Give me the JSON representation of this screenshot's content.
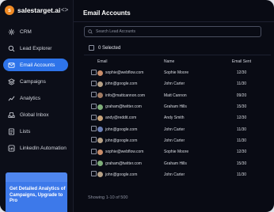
{
  "app": {
    "brand": "salestarget.ai",
    "logo_letter": "s",
    "collapse_glyph": "<>"
  },
  "sidebar": {
    "items": [
      {
        "label": "CRM",
        "icon": "crm-icon"
      },
      {
        "label": "Lead Explorer",
        "icon": "lead-explorer-icon"
      },
      {
        "label": "Email Accounts",
        "icon": "email-icon",
        "active": true
      },
      {
        "label": "Campaigns",
        "icon": "campaigns-icon"
      },
      {
        "label": "Analytics",
        "icon": "analytics-icon"
      },
      {
        "label": "Global Inbox",
        "icon": "inbox-icon"
      },
      {
        "label": "Lists",
        "icon": "lists-icon"
      },
      {
        "label": "LinkedIn Automation",
        "icon": "linkedin-icon"
      }
    ],
    "promo": "Get Detailed Analytics of Campaigns, Upgrade to Pro"
  },
  "main": {
    "title": "Email Accounts",
    "search": {
      "placeholder": "Search Lead Accounts",
      "value": ""
    },
    "selected_label": "0 Selected",
    "columns": {
      "email": "Email",
      "name": "Name",
      "sent": "Email Sent"
    },
    "rows": [
      {
        "email": "sophie@webflow.com",
        "name": "Sophie Moore",
        "sent": "12/30",
        "avatar_color": "#c98d6a"
      },
      {
        "email": "john@google.com",
        "name": "John Carter",
        "sent": "11/30",
        "avatar_color": "#b5a086"
      },
      {
        "email": "info@mattcannon.com",
        "name": "Matt Cannon",
        "sent": "09/20",
        "avatar_color": "#a07a62"
      },
      {
        "email": "graham@twitter.com",
        "name": "Graham Hills",
        "sent": "15/30",
        "avatar_color": "#7fae7a"
      },
      {
        "email": "andy@reddit.com",
        "name": "Andy Smith",
        "sent": "12/30",
        "avatar_color": "#caa57a"
      },
      {
        "email": "john@google.com",
        "name": "John Carter",
        "sent": "11/30",
        "avatar_color": "#6b7fb5"
      },
      {
        "email": "john@google.com",
        "name": "John Carter",
        "sent": "11/30",
        "avatar_color": "#b5a086"
      },
      {
        "email": "sophie@webflow.com",
        "name": "Sophie Moore",
        "sent": "12/30",
        "avatar_color": "#c98d6a"
      },
      {
        "email": "graham@twitter.com",
        "name": "Graham Hills",
        "sent": "15/30",
        "avatar_color": "#7fae7a"
      },
      {
        "email": "john@google.com",
        "name": "John Carter",
        "sent": "11/30",
        "avatar_color": "#b5a086"
      }
    ],
    "footer": "Showing 1-10 of 500"
  }
}
